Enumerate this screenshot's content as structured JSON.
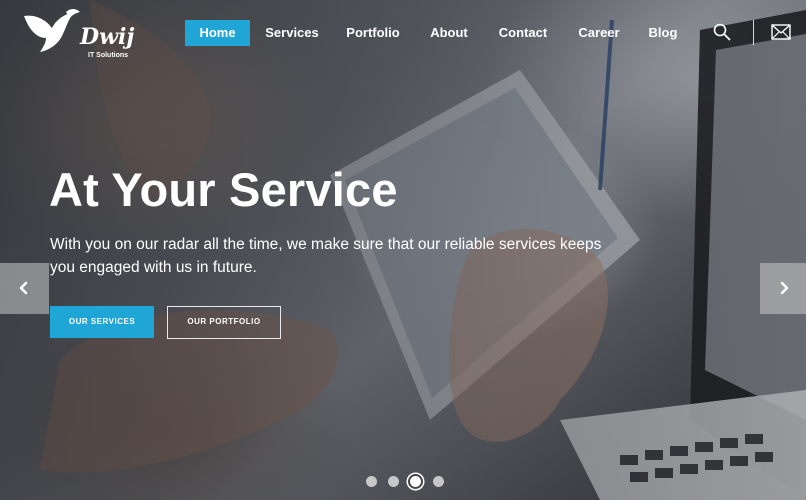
{
  "brand": {
    "name": "Dwij",
    "tagline": "IT Solutions"
  },
  "nav": {
    "items": [
      {
        "label": "Home",
        "active": true
      },
      {
        "label": "Services"
      },
      {
        "label": "Portfolio"
      },
      {
        "label": "About"
      },
      {
        "label": "Contact"
      },
      {
        "label": "Career"
      },
      {
        "label": "Blog"
      }
    ],
    "icons": [
      "search-icon",
      "mail-icon"
    ]
  },
  "hero": {
    "headline": "At Your Service",
    "subtitle": "With you on our radar all the time, we make sure that our reliable services keeps you engaged with us in future.",
    "primary_button": "OUR SERVICES",
    "secondary_button": "OUR PORTFOLIO"
  },
  "slider": {
    "slide_count": 4,
    "active_slide": 3
  },
  "colors": {
    "accent": "#1fa5d6",
    "text": "#ffffff"
  }
}
